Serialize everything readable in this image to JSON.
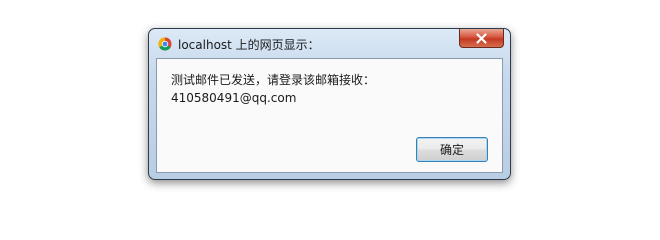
{
  "dialog": {
    "title": "localhost 上的网页显示：",
    "app_icon": "chrome-icon",
    "close_icon": "close-icon",
    "message_lines": [
      "测试邮件已发送，请登录该邮箱接收：",
      "410580491@qq.com"
    ],
    "ok_label": "确定"
  },
  "colors": {
    "frame": "#c7d9ec",
    "close_button": "#d7553e",
    "button_focus": "#3c7fb1"
  }
}
